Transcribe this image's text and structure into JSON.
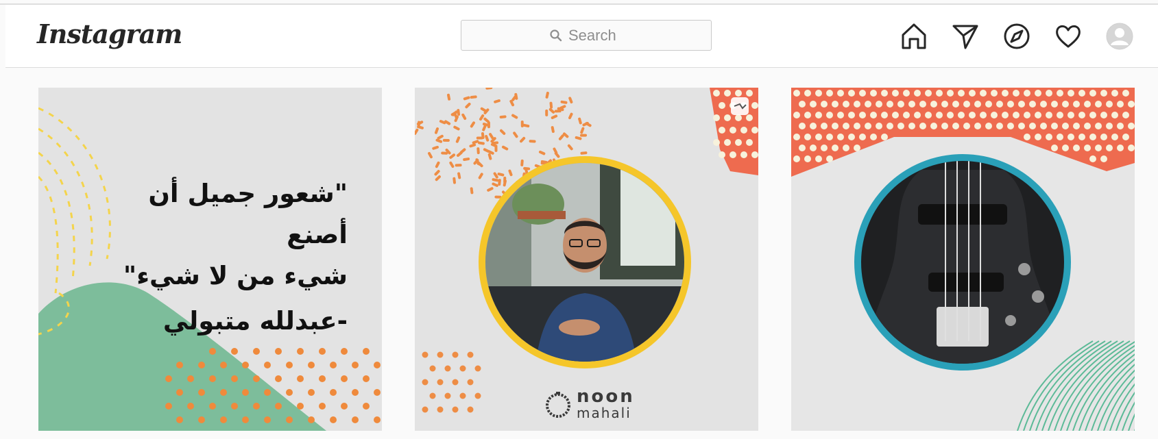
{
  "app": {
    "logo_text": "Instagram"
  },
  "search": {
    "placeholder": "Search"
  },
  "nav": [
    {
      "name": "home-icon"
    },
    {
      "name": "direct-icon"
    },
    {
      "name": "explore-icon"
    },
    {
      "name": "activity-icon"
    },
    {
      "name": "profile-avatar"
    }
  ],
  "posts": [
    {
      "quote_line1": "\"شعور جميل أن أصنع",
      "quote_line2": "شيء من لا شيء\"",
      "quote_author": "-عبدلله متبولي",
      "colors": {
        "bg": "#e3e3e3",
        "green": "#7dbd9b",
        "yellow": "#f4d44b",
        "orange": "#ef8a3c"
      }
    },
    {
      "brand_name": "noon",
      "brand_sub": "mahali",
      "colors": {
        "bg": "#e3e3e3",
        "ring": "#f5c62a",
        "orange": "#ee8d45",
        "coral": "#ee6b4f"
      }
    },
    {
      "colors": {
        "bg": "#e6e6e6",
        "coral": "#ee6b4f",
        "ring": "#2aa0b8",
        "green": "#5cba97"
      }
    }
  ]
}
